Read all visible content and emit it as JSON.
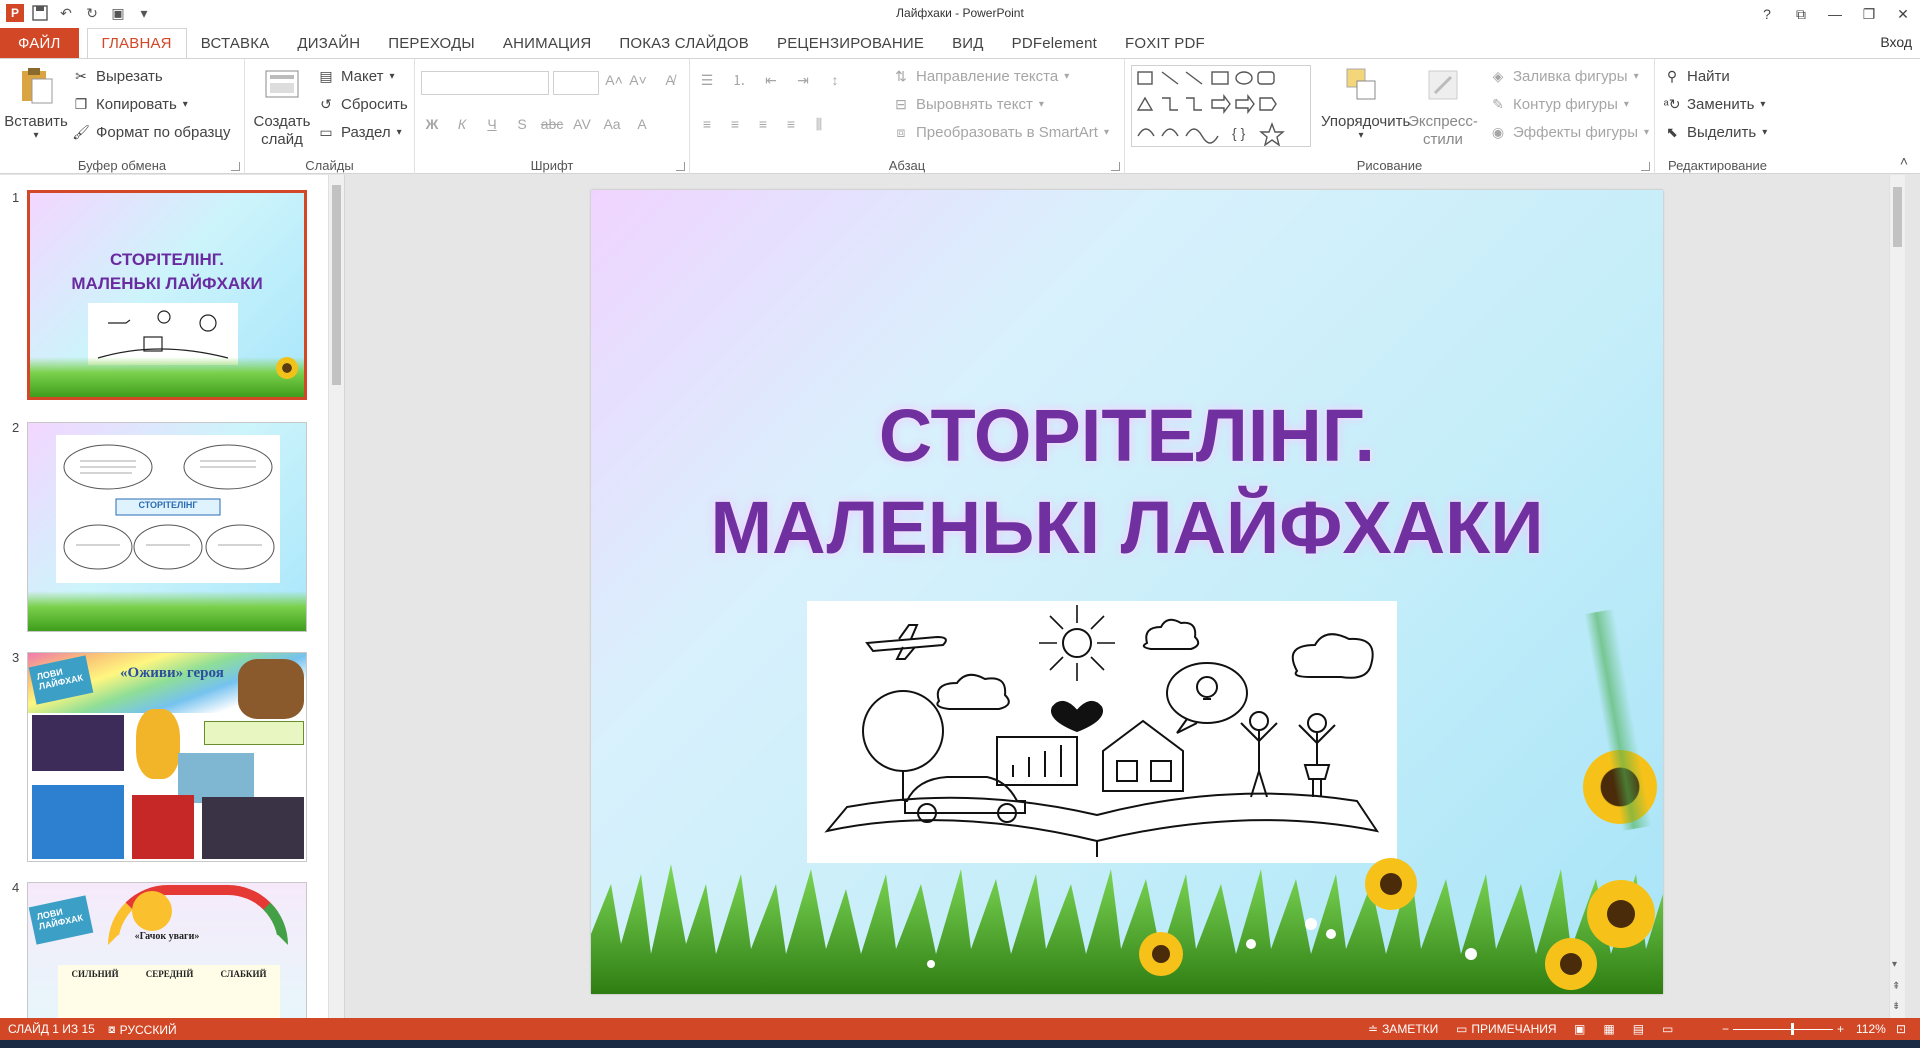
{
  "window": {
    "title": "Лайфхаки - PowerPoint",
    "signin": "Вход"
  },
  "tabs": [
    "ФАЙЛ",
    "ГЛАВНАЯ",
    "ВСТАВКА",
    "ДИЗАЙН",
    "ПЕРЕХОДЫ",
    "АНИМАЦИЯ",
    "ПОКАЗ СЛАЙДОВ",
    "РЕЦЕНЗИРОВАНИЕ",
    "ВИД",
    "PDFelement",
    "FOXIT PDF"
  ],
  "ribbon": {
    "clipboard": {
      "paste": "Вставить",
      "cut": "Вырезать",
      "copy": "Копировать",
      "format_painter": "Формат по образцу",
      "label": "Буфер обмена"
    },
    "slides": {
      "new_slide": "Создать слайд",
      "layout": "Макет",
      "reset": "Сбросить",
      "section": "Раздел",
      "label": "Слайды"
    },
    "font": {
      "label": "Шрифт"
    },
    "paragraph": {
      "text_direction": "Направление текста",
      "align_text": "Выровнять текст",
      "smartart": "Преобразовать в SmartArt",
      "label": "Абзац"
    },
    "drawing": {
      "arrange": "Упорядочить",
      "quick_styles": "Экспресс-стили",
      "shape_fill": "Заливка фигуры",
      "shape_outline": "Контур фигуры",
      "shape_effects": "Эффекты фигуры",
      "label": "Рисование"
    },
    "editing": {
      "find": "Найти",
      "replace": "Заменить",
      "select": "Выделить",
      "label": "Редактирование"
    }
  },
  "thumbnails": [
    {
      "num": "1",
      "title": "СТОРІТЕЛІНГ. МАЛЕНЬКІ ЛАЙФХАКИ"
    },
    {
      "num": "2",
      "center_label": "СТОРІТЕЛІНГ"
    },
    {
      "num": "3",
      "title": "«Оживи» героя",
      "badge": "ЛОВИ ЛАЙФХАК"
    },
    {
      "num": "4",
      "title": "«Гачок уваги»",
      "badge": "ЛОВИ ЛАЙФХАК",
      "cols": [
        "СИЛЬНИЙ",
        "СЕРЕДНІЙ",
        "СЛАБКИЙ"
      ]
    }
  ],
  "slide": {
    "title_line1": "СТОРІТЕЛІНГ.",
    "title_line2": "МАЛЕНЬКІ ЛАЙФХАКИ"
  },
  "status": {
    "slide_info": "СЛАЙД 1 ИЗ 15",
    "language": "РУССКИЙ",
    "notes": "ЗАМЕТКИ",
    "comments": "ПРИМЕЧАНИЯ",
    "zoom": "112%"
  },
  "colors": {
    "accent": "#d24726",
    "title_purple": "#7030a0"
  }
}
